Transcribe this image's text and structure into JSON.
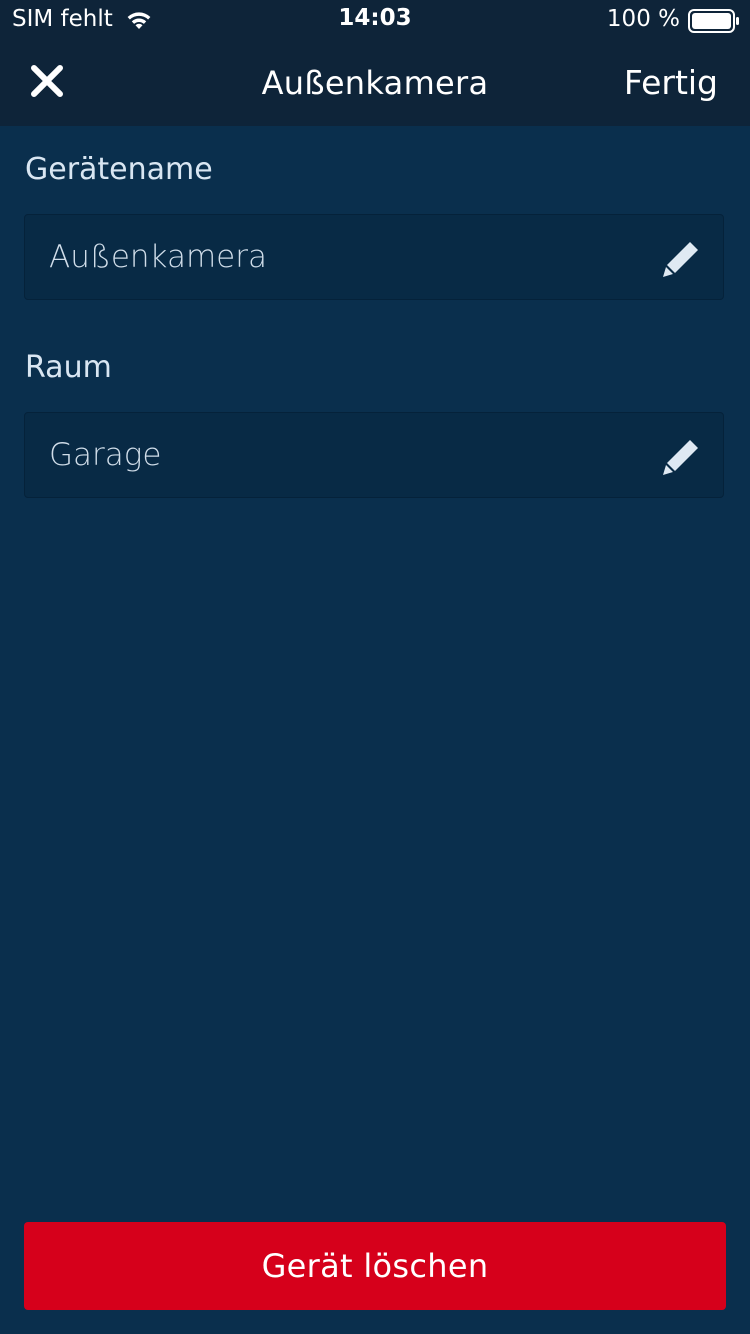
{
  "status_bar": {
    "carrier": "SIM fehlt",
    "time": "14:03",
    "battery": "100 %"
  },
  "nav": {
    "title": "Außenkamera",
    "done_label": "Fertig",
    "close_icon": "close-icon"
  },
  "form": {
    "device_name": {
      "label": "Gerätename",
      "value": "Außenkamera",
      "icon": "pencil-icon"
    },
    "room": {
      "label": "Raum",
      "value": "Garage",
      "icon": "pencil-icon"
    }
  },
  "actions": {
    "delete_label": "Gerät löschen"
  },
  "colors": {
    "background": "#0a2f4d",
    "header": "#0e2439",
    "field": "#082a45",
    "danger": "#d6001b"
  }
}
